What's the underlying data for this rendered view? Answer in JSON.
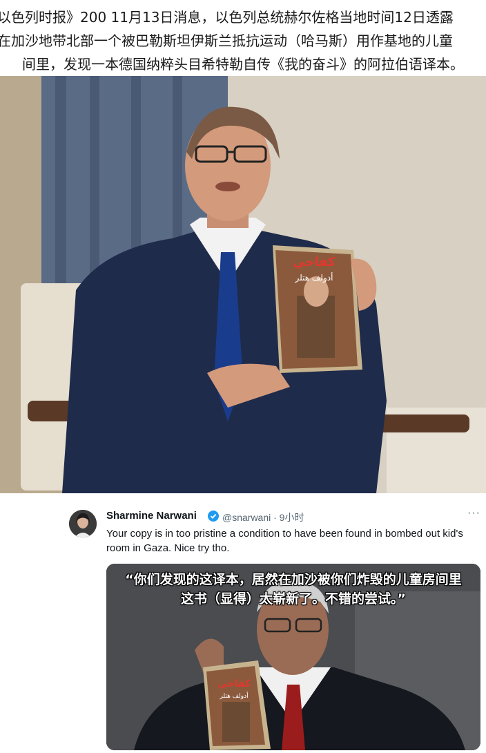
{
  "news": {
    "line1": "以色列时报》200   11月13日消息，以色列总统赫尔佐格当地时间12日透露",
    "line2": "在加沙地带北部一个被巴勒斯坦伊斯兰抵抗运动（哈马斯）用作基地的儿童",
    "line3": "间里，发现一本德国纳粹头目希特勒自传《我的奋斗》的阿拉伯语译本。"
  },
  "photo": {
    "book_title_arabic": "كفاحي",
    "book_author_arabic": "أدولف هتلر"
  },
  "tweet": {
    "name": "Sharmine Narwani",
    "handle_time": "@snarwani · 9小时",
    "more": "···",
    "body": "Your copy is in too pristine a condition to have been found in bombed out kid's room in Gaza. Nice try tho.",
    "caption_line1": "“你们发现的这译本，居然在加沙被你们炸毁的儿童房间里",
    "caption_line2": "这书（显得）太崭新了。不错的尝试。”",
    "colors": {
      "verified": "#1d9bf0",
      "tie": "#9b1c1c"
    }
  }
}
